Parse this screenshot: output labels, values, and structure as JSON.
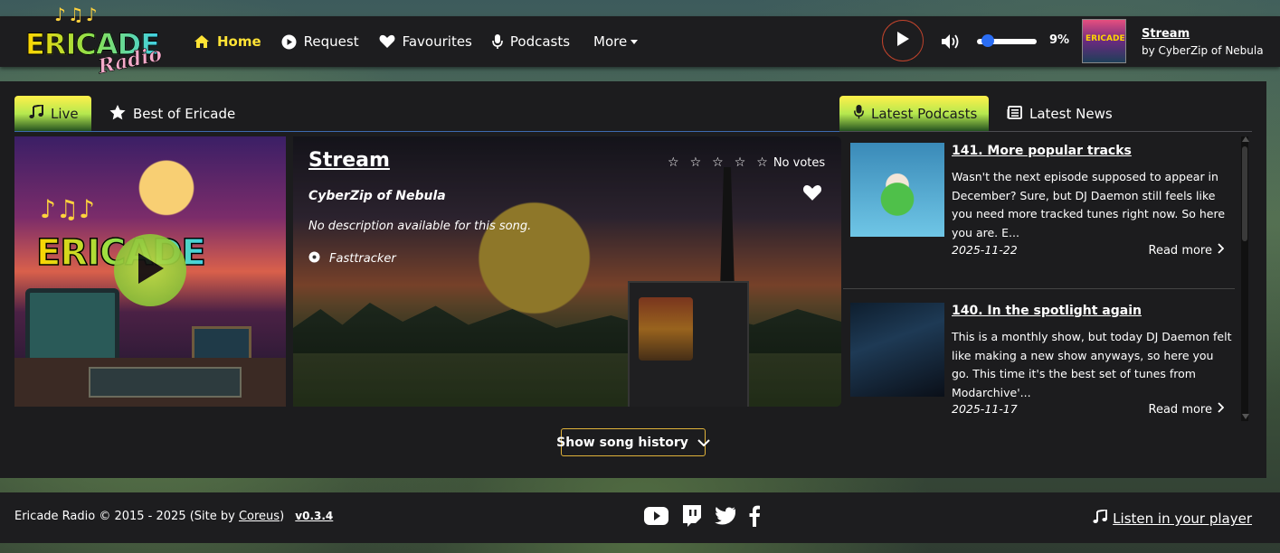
{
  "brand": {
    "name_line1": "ERICADE",
    "name_line2": "Radio"
  },
  "nav": {
    "items": [
      {
        "label": "Home",
        "icon": "home-icon",
        "active": true
      },
      {
        "label": "Request",
        "icon": "play-circle-icon"
      },
      {
        "label": "Favourites",
        "icon": "heart-icon"
      },
      {
        "label": "Podcasts",
        "icon": "microphone-icon"
      },
      {
        "label": "More",
        "icon": "caret-down-icon"
      }
    ]
  },
  "player": {
    "volume_percent": "9%",
    "volume_level": 0.09,
    "now_playing_title": "Stream",
    "now_playing_artist": "by CyberZip of Nebula",
    "thumb_text": "ERICADE"
  },
  "tabs_left": [
    {
      "label": "Live",
      "icon": "music-note-icon",
      "active": true
    },
    {
      "label": "Best of Ericade",
      "icon": "star-icon"
    }
  ],
  "tabs_right": [
    {
      "label": "Latest Podcasts",
      "icon": "microphone-icon",
      "active": true
    },
    {
      "label": "Latest News",
      "icon": "newspaper-icon"
    }
  ],
  "song": {
    "art_word": "ERICADE",
    "title": "Stream",
    "artist": "CyberZip of Nebula",
    "description": "No description available for this song.",
    "tracker": "Fasttracker",
    "votes": "No votes",
    "star_count": 5
  },
  "history_button": "Show song history",
  "podcasts": [
    {
      "title": "141. More popular tracks",
      "text": "Wasn't the next episode supposed to appear in December? Sure, but DJ Daemon still feels like you need more tracked tunes right now. So here you are. E...",
      "date": "2025-11-22",
      "more": "Read more"
    },
    {
      "title": "140. In the spotlight again",
      "text": "This is a monthly show, but today DJ Daemon felt like making a new show anyways, so here you go. This time it's the best set of tunes from Modarchive'...",
      "date": "2025-11-17",
      "more": "Read more"
    }
  ],
  "footer": {
    "copyright": "Ericade Radio © 2015 - 2025 (Site by ",
    "site_by": "Coreus",
    "close": ")",
    "version": "v0.3.4",
    "listen": "Listen in your player"
  },
  "colors": {
    "accent": "#ffe335",
    "panel": "#1c1c1e",
    "navbar": "#1d1d1f",
    "slider_knob": "#2a6df4"
  }
}
